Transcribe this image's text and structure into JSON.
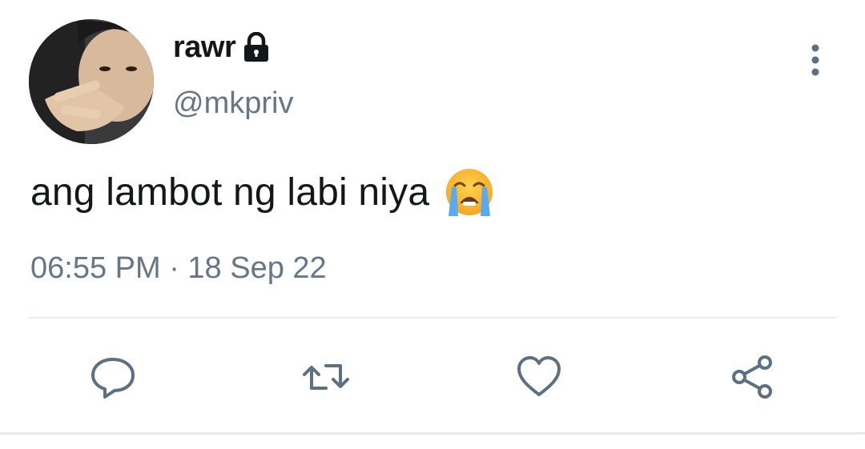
{
  "tweet": {
    "display_name": "rawr",
    "handle": "@mkpriv",
    "text": "ang lambot ng labi niya",
    "emoji": "loudly-crying-face",
    "timestamp": "06:55 PM · 18 Sep 22",
    "protected": true
  },
  "actions": [
    {
      "name": "reply",
      "icon": "comment-icon"
    },
    {
      "name": "retweet",
      "icon": "retweet-icon"
    },
    {
      "name": "like",
      "icon": "heart-icon"
    },
    {
      "name": "share",
      "icon": "share-icon"
    }
  ],
  "colors": {
    "text_primary": "#14171a",
    "text_secondary": "#657786",
    "icon": "#5b7083",
    "divider": "#e6ecf0"
  }
}
